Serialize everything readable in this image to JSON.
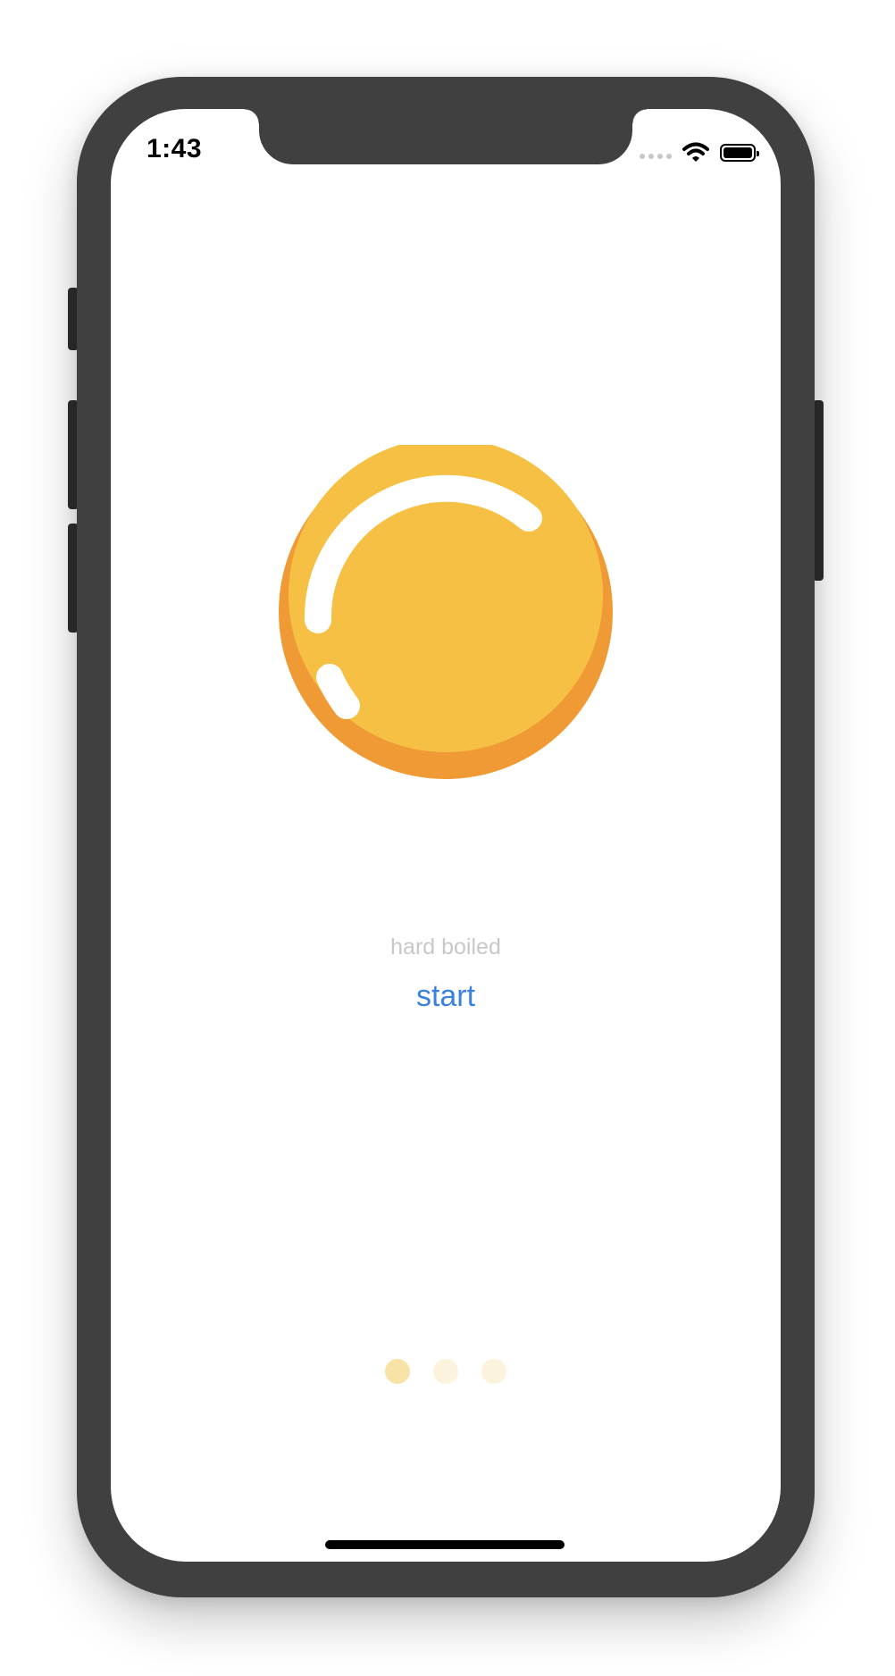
{
  "status_bar": {
    "time": "1:43"
  },
  "egg": {
    "icon": "egg-yolk-icon",
    "colors": {
      "yolk": "#f5c044",
      "shadow": "#f09a35",
      "highlight": "#ffffff"
    }
  },
  "main": {
    "egg_label": "hard boiled",
    "start_label": "start",
    "accent_color": "#3b82e0"
  },
  "pager": {
    "count": 3,
    "active_index": 0,
    "active_color": "#f8e3a6",
    "inactive_color": "#fcf3dc"
  }
}
